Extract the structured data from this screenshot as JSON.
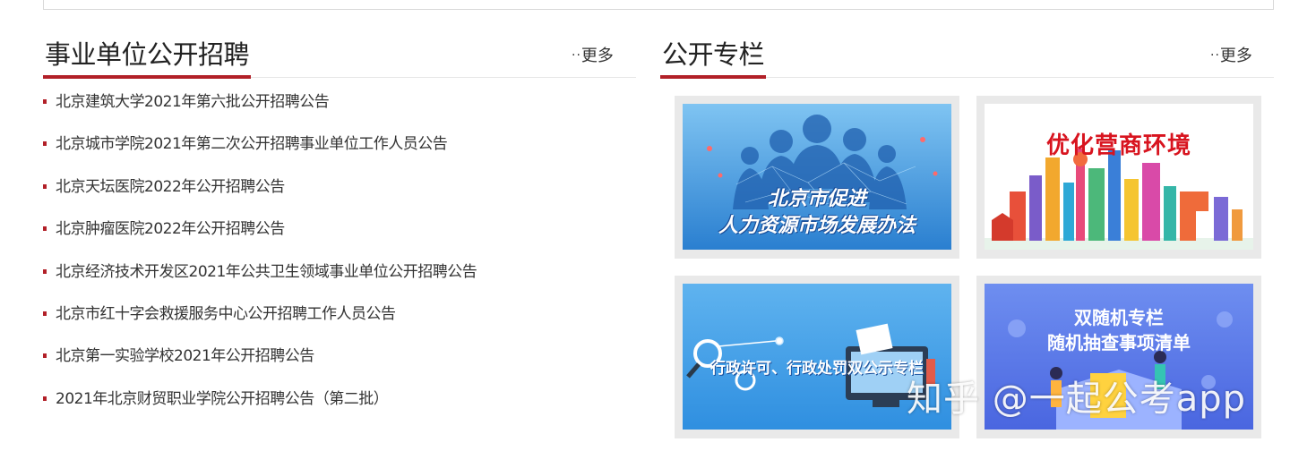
{
  "left_section": {
    "title": "事业单位公开招聘",
    "more_label": "更多",
    "more_prefix": "··",
    "items": [
      {
        "label": "北京建筑大学2021年第六批公开招聘公告"
      },
      {
        "label": "北京城市学院2021年第二次公开招聘事业单位工作人员公告"
      },
      {
        "label": "北京天坛医院2022年公开招聘公告"
      },
      {
        "label": "北京肿瘤医院2022年公开招聘公告"
      },
      {
        "label": "北京经济技术开发区2021年公共卫生领域事业单位公开招聘公告"
      },
      {
        "label": "北京市红十字会救援服务中心公开招聘工作人员公告"
      },
      {
        "label": "北京第一实验学校2021年公开招聘公告"
      },
      {
        "label": "2021年北京财贸职业学院公开招聘公告（第二批）"
      }
    ]
  },
  "right_section": {
    "title": "公开专栏",
    "more_label": "更多",
    "more_prefix": "··",
    "cards": [
      {
        "line1": "北京市促进",
        "line2": "人力资源市场发展办法"
      },
      {
        "line1": "优化营商环境"
      },
      {
        "line1": "行政许可、行政处罚双公示专栏"
      },
      {
        "line1": "双随机专栏",
        "line2": "随机抽查事项清单"
      }
    ]
  },
  "watermark": "知乎 @一起公考app",
  "colors": {
    "accent": "#b22028",
    "card_blue": "#3d9be0",
    "card_border": "#e9e9e9"
  }
}
